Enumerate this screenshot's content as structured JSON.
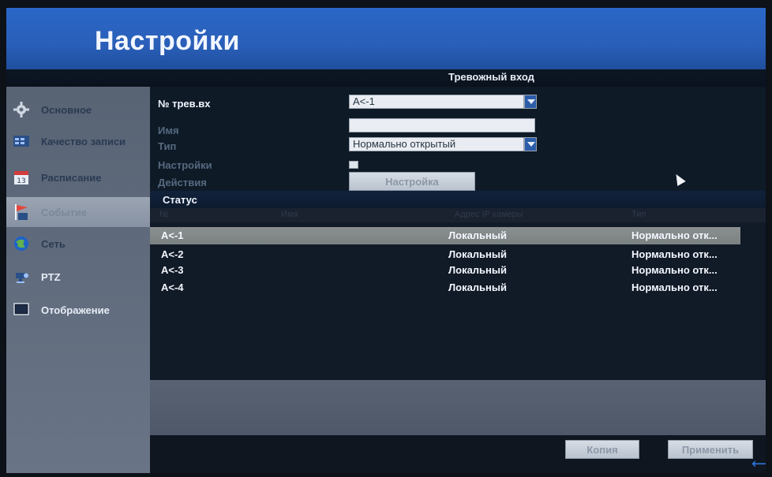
{
  "window": {
    "title": "Настройки",
    "section_title": "Тревожный вход"
  },
  "sidebar": {
    "items": [
      {
        "label": "Основное",
        "icon": "gear-icon"
      },
      {
        "label": "Качество записи",
        "icon": "record-quality-icon"
      },
      {
        "label": "Расписание",
        "icon": "calendar-icon"
      },
      {
        "label": "Событие",
        "icon": "event-flag-icon",
        "active": true
      },
      {
        "label": "Сеть",
        "icon": "network-globe-icon"
      },
      {
        "label": "PTZ",
        "icon": "ptz-camera-icon"
      },
      {
        "label": "Отображение",
        "icon": "display-monitor-icon"
      }
    ]
  },
  "form": {
    "alarm_input_label": "№ трев.вх",
    "alarm_input_value": "A<-1",
    "name_label": "Имя",
    "name_value": "",
    "type_label": "Тип",
    "type_value": "Нормально открытый",
    "settings_label": "Настройки",
    "actions_label": "Действия",
    "actions_button": "Настройка"
  },
  "status": {
    "title": "Статус",
    "columns": [
      "№",
      "Имя",
      "Адрес IP камеры",
      "Тип"
    ],
    "rows": [
      {
        "id": "A<-1",
        "source": "Локальный",
        "type": "Нормально отк..."
      },
      {
        "id": "A<-2",
        "source": "Локальный",
        "type": "Нормально отк..."
      },
      {
        "id": "A<-3",
        "source": "Локальный",
        "type": "Нормально отк..."
      },
      {
        "id": "A<-4",
        "source": "Локальный",
        "type": "Нормально отк..."
      }
    ]
  },
  "footer": {
    "copy_button": "Копия",
    "apply_button": "Применить"
  },
  "colors": {
    "title_bar": "#2a67c7",
    "sidebar": "#5e6a7b",
    "selected_row": "#868c8c",
    "accent_dropdown": "#2c5da9"
  }
}
